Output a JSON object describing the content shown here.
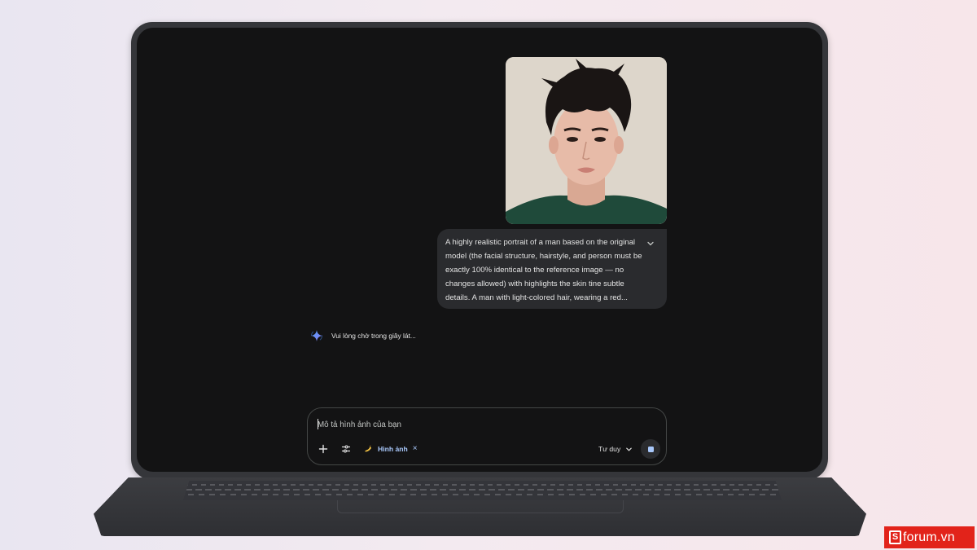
{
  "chat": {
    "user_image": {
      "alt": "portrait-photo"
    },
    "prompt_text": "A highly realistic portrait of a man based on the original model (the facial structure, hairstyle, and person must be exactly 100% identical to the reference image — no changes allowed) with highlights the skin tine subtle details. A man with light-colored hair, wearing a red...",
    "loading_text": "Vui lòng chờ trong giây lát..."
  },
  "input": {
    "placeholder": "Mô tả hình ảnh của bạn",
    "value": "",
    "chip_label": "Hình ảnh",
    "chip_close": "×",
    "mode_label": "Tư duy"
  },
  "icons": {
    "spark": "gemini-spark-icon",
    "add": "plus-icon",
    "tools": "tune-icon",
    "chip": "banana-icon",
    "expand": "chevron-down-icon",
    "mode": "chevron-down-icon",
    "stop": "stop-icon"
  },
  "watermark": {
    "logo_letter": "S",
    "text": "forum.vn"
  },
  "colors": {
    "screen_bg": "#131314",
    "bubble_bg": "#2a2b2e",
    "accent": "#a8c7fa",
    "watermark_bg": "#e2231a"
  }
}
